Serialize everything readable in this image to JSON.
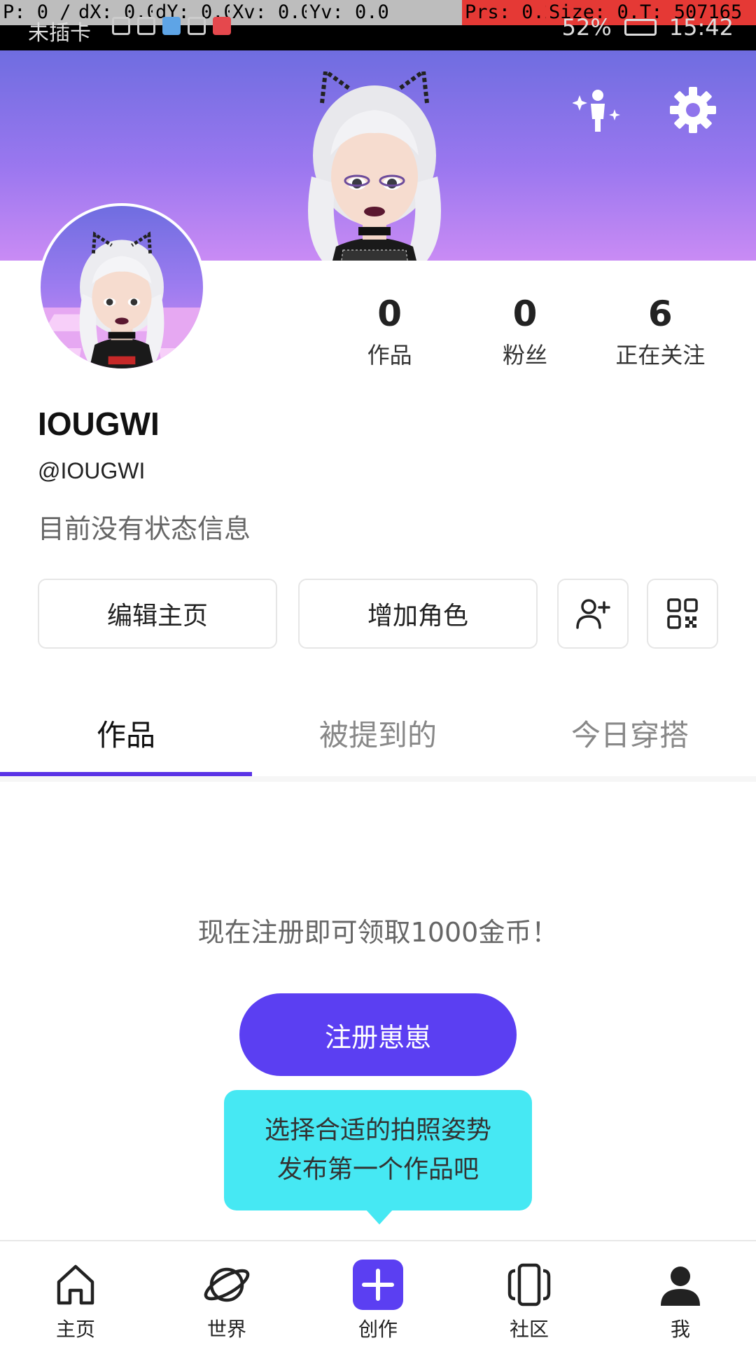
{
  "status_bar": {
    "debug": [
      "P: 0 / 1",
      "dX: 0.0",
      "dY: 0.0",
      "Xv: 0.0",
      "Yv: 0.0",
      "Prs: 0.20",
      "Size: 0.40",
      "T: 507165"
    ],
    "carrier": "未插卡",
    "battery": "52%",
    "time": "15:42"
  },
  "profile": {
    "stats": [
      {
        "value": "0",
        "label": "作品"
      },
      {
        "value": "0",
        "label": "粉丝"
      },
      {
        "value": "6",
        "label": "正在关注"
      }
    ],
    "name": "IOUGWI",
    "handle": "@IOUGWI",
    "bio": "目前没有状态信息"
  },
  "actions": {
    "edit_label": "编辑主页",
    "add_character_label": "增加角色",
    "add_friend_icon": "add-friend-icon",
    "qr_icon": "qr-code-icon"
  },
  "tabs": [
    {
      "label": "作品",
      "active": true
    },
    {
      "label": "被提到的",
      "active": false
    },
    {
      "label": "今日穿搭",
      "active": false
    }
  ],
  "content": {
    "promo_text": "现在注册即可领取1000金币！",
    "register_label": "注册崽崽",
    "tooltip_line1": "选择合适的拍照姿势",
    "tooltip_line2": "发布第一个作品吧"
  },
  "nav": [
    {
      "label": "主页",
      "icon": "home-icon"
    },
    {
      "label": "世界",
      "icon": "planet-icon"
    },
    {
      "label": "创作",
      "icon": "plus-icon"
    },
    {
      "label": "社区",
      "icon": "cards-icon"
    },
    {
      "label": "我",
      "icon": "person-icon"
    }
  ],
  "colors": {
    "accent": "#5b3ff2",
    "tooltip": "#46e8f3",
    "banner_top": "#6f6de0",
    "banner_bottom": "#c98bf4"
  }
}
